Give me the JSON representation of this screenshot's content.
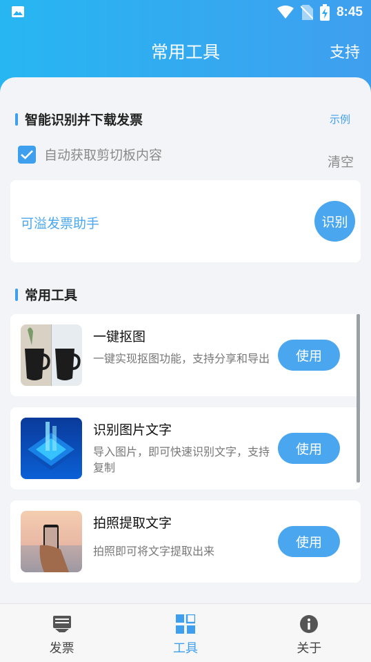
{
  "status_bar": {
    "time": "8:45"
  },
  "header": {
    "title": "常用工具",
    "support_label": "支持"
  },
  "invoice_section": {
    "title": "智能识别并下载发票",
    "example_label": "示例",
    "auto_clipboard_label": "自动获取剪切板内容",
    "auto_clipboard_checked": true,
    "clear_label": "清空",
    "assistant_text": "可溢发票助手",
    "recognize_label": "识别"
  },
  "tools_section": {
    "title": "常用工具",
    "tools": [
      {
        "name": "一键抠图",
        "desc": "一键实现抠图功能，支持分享和导出",
        "button": "使用"
      },
      {
        "name": "识别图片文字",
        "desc": "导入图片，即可快速识别文字，支持复制",
        "button": "使用"
      },
      {
        "name": "拍照提取文字",
        "desc": "拍照即可将文字提取出来",
        "button": "使用"
      }
    ]
  },
  "bottom_nav": {
    "items": [
      {
        "label": "发票",
        "icon": "invoice-icon"
      },
      {
        "label": "工具",
        "icon": "grid-icon",
        "active": true
      },
      {
        "label": "关于",
        "icon": "info-icon"
      }
    ]
  },
  "colors": {
    "accent": "#3f9fef",
    "button": "#4aa7ef",
    "header_start": "#27b6f2"
  }
}
